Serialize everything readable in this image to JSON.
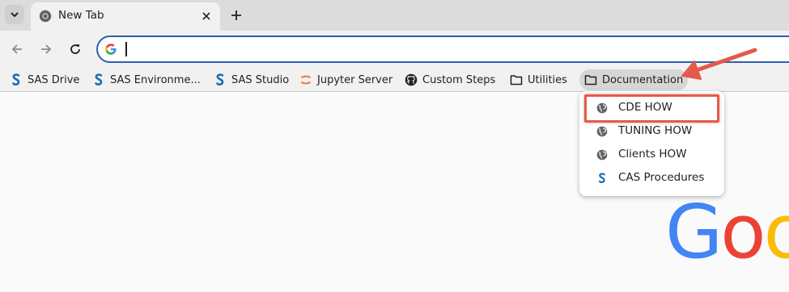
{
  "browser": {
    "tab": {
      "title": "New Tab"
    },
    "address_bar": {
      "value": "",
      "placeholder": ""
    }
  },
  "bookmarks": [
    {
      "label": "SAS Drive",
      "icon": "sas-icon"
    },
    {
      "label": "SAS Environme...",
      "icon": "sas-icon"
    },
    {
      "label": "SAS Studio",
      "icon": "sas-icon"
    },
    {
      "label": "Jupyter Server",
      "icon": "jupyter-icon"
    },
    {
      "label": "Custom Steps",
      "icon": "github-icon"
    },
    {
      "label": "Utilities",
      "icon": "folder-icon"
    },
    {
      "label": "Documentation",
      "icon": "folder-icon"
    }
  ],
  "dropdown": {
    "items": [
      {
        "label": "CDE HOW",
        "icon": "globe-icon"
      },
      {
        "label": "TUNING HOW",
        "icon": "globe-icon"
      },
      {
        "label": "Clients HOW",
        "icon": "globe-icon"
      },
      {
        "label": "CAS Procedures",
        "icon": "sas-icon"
      }
    ]
  },
  "google_logo": {
    "letters": [
      "G",
      "o",
      "o"
    ]
  },
  "colors": {
    "annotation": "#e45a4a",
    "sas_blue": "#1b6cb4",
    "jupyter_orange": "#f37726",
    "google_blue": "#4285f4",
    "google_red": "#ea4335",
    "google_yellow": "#fbbc05"
  }
}
